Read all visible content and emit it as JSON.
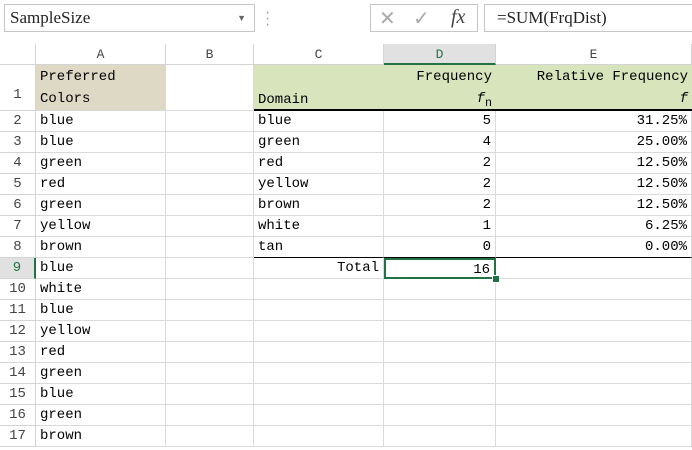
{
  "name_box": "SampleSize",
  "formula": "=SUM(FrqDist)",
  "columns": [
    "A",
    "B",
    "C",
    "D",
    "E"
  ],
  "selected_cell": "D9",
  "header": {
    "a_line1": "Preferred",
    "a_line2": "Colors",
    "c": "Domain",
    "d_line1": "Frequency",
    "d_sym": "f",
    "d_sub": "n",
    "e_line1": "Relative Frequency",
    "e_sym": "f"
  },
  "colors_list": [
    "blue",
    "blue",
    "green",
    "red",
    "green",
    "yellow",
    "brown",
    "blue",
    "white",
    "blue",
    "yellow",
    "red",
    "green",
    "blue",
    "green",
    "brown"
  ],
  "freq_table": [
    {
      "domain": "blue",
      "freq": "5",
      "rel": "31.25%"
    },
    {
      "domain": "green",
      "freq": "4",
      "rel": "25.00%"
    },
    {
      "domain": "red",
      "freq": "2",
      "rel": "12.50%"
    },
    {
      "domain": "yellow",
      "freq": "2",
      "rel": "12.50%"
    },
    {
      "domain": "brown",
      "freq": "2",
      "rel": "12.50%"
    },
    {
      "domain": "white",
      "freq": "1",
      "rel": "6.25%"
    },
    {
      "domain": "tan",
      "freq": "0",
      "rel": "0.00%"
    }
  ],
  "total_label": "Total",
  "total_value": "16",
  "colors": {
    "header_a_bg": "#ddd9c4",
    "header_table_bg": "#d8e4bc",
    "accent": "#217346"
  }
}
